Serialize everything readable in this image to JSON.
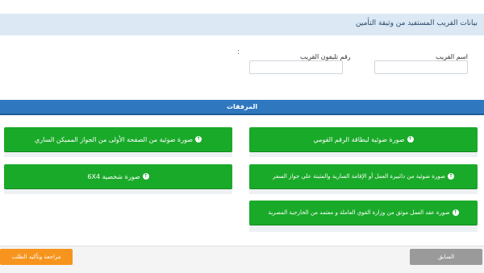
{
  "section": {
    "title": "بيانات القريب المستفيد من وثيقة التأمين"
  },
  "form": {
    "relative_name_label": "اسم القريب",
    "relative_name_value": "",
    "relative_phone_label": "رقم تليفون القريب",
    "relative_phone_value": "",
    "separator": ":"
  },
  "attachments": {
    "title": "المرفقات",
    "upload_icon": "upload-circle-icon",
    "buttons": [
      "صورة ضوئية لبطاقة الرقم القومي",
      "صورة ضوئية من الصفحة الأولى من الجواز المميكن الساري",
      "صورة ضوئية من دائبيرة العمل أو الإقامة السارية والمثبتة علي جواز السفر",
      "صورة شخصية 6X4",
      "صورة عقد العمل موثق من وزارة القوي العاملة و معتمد من الخارجية المصرية"
    ]
  },
  "footer": {
    "back_label": "السابق",
    "review_label": "مراجعة وتأكيد الطلب"
  },
  "colors": {
    "green": "#1aaa2a",
    "blue_bar": "#2f78c0",
    "orange": "#f7941d",
    "gray": "#9a9a9a"
  }
}
